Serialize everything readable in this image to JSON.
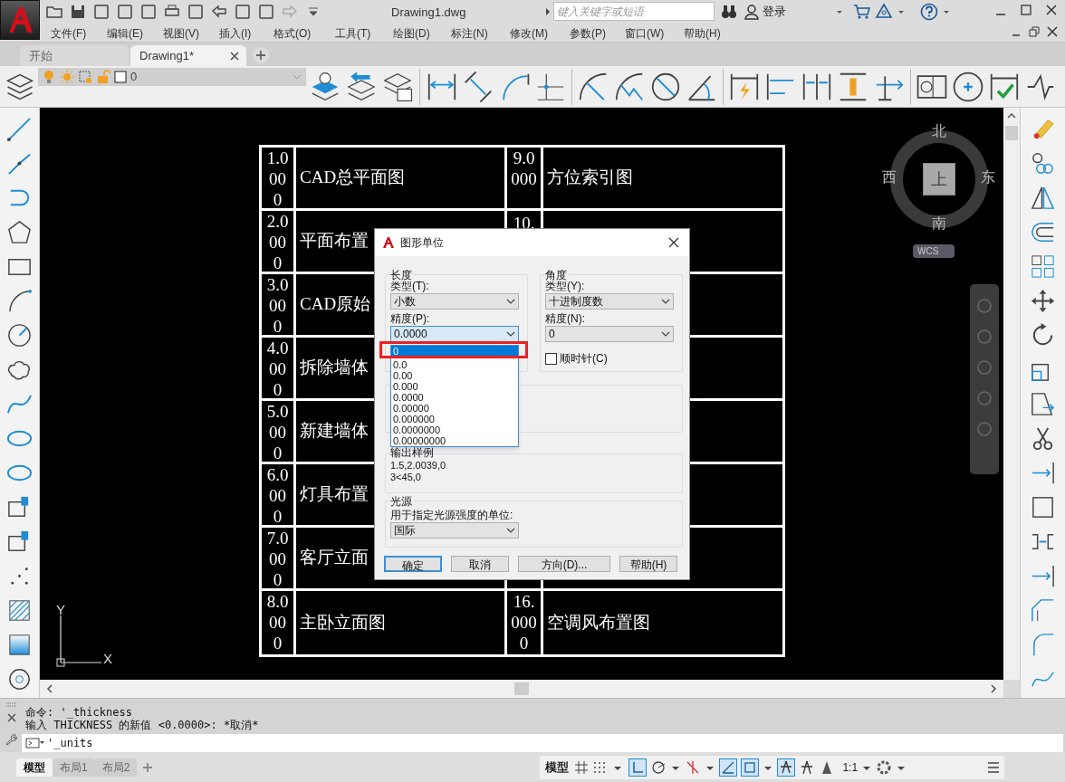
{
  "app": {
    "title": "Drawing1.dwg",
    "search": {
      "placeholder": "键入关键字或短语"
    },
    "login": "登录"
  },
  "menu": [
    "文件(F)",
    "编辑(E)",
    "视图(V)",
    "插入(I)",
    "格式(O)",
    "工具(T)",
    "绘图(D)",
    "标注(N)",
    "修改(M)",
    "参数(P)",
    "窗口(W)",
    "帮助(H)"
  ],
  "doc_tabs": [
    {
      "label": "开始",
      "selected": false
    },
    {
      "label": "Drawing1*",
      "selected": true
    }
  ],
  "layer": {
    "name": "0"
  },
  "drawing_table": {
    "rows": [
      {
        "num": "1.0000",
        "name": "CAD总平面图",
        "num2": "9.0000",
        "name2": "方位索引图"
      },
      {
        "num": "2.0000",
        "name": "平面布置",
        "num2": "10."
      },
      {
        "num": "3.0000",
        "name": "CAD原始"
      },
      {
        "num": "4.0000",
        "name": "拆除墙体"
      },
      {
        "num": "5.0000",
        "name": "新建墙体"
      },
      {
        "num": "6.0000",
        "name": "灯具布置"
      },
      {
        "num": "7.0000",
        "name": "客厅立面"
      },
      {
        "num": "8.0000",
        "name": "主卧立面图",
        "num2": "16.0000",
        "name2": "空调风布置图"
      }
    ]
  },
  "viewcube": {
    "north": "北",
    "south": "南",
    "east": "东",
    "west": "西",
    "top": "上",
    "wcs": "WCS"
  },
  "ucs": {
    "x": "X",
    "y": "Y"
  },
  "dialog": {
    "title": "图形单位",
    "length": {
      "label": "长度",
      "type_label": "类型(T):",
      "type": "小数",
      "precision_label": "精度(P):",
      "precision": "0.0000",
      "options": [
        {
          "label": "0",
          "selected": true
        },
        {
          "label": "0.0",
          "selected": false
        },
        {
          "label": "0.00",
          "selected": false
        },
        {
          "label": "0.000",
          "selected": false
        },
        {
          "label": "0.0000",
          "selected": false
        },
        {
          "label": "0.00000",
          "selected": false
        },
        {
          "label": "0.000000",
          "selected": false
        },
        {
          "label": "0.0000000",
          "selected": false
        },
        {
          "label": "0.00000000",
          "selected": false
        }
      ]
    },
    "angle": {
      "label": "角度",
      "type_label": "类型(Y):",
      "type": "十进制度数",
      "precision_label": "精度(N):",
      "precision": "0",
      "clockwise": {
        "label": "顺时针(C)",
        "checked": false
      }
    },
    "sample": {
      "label": "输出样例",
      "lines": [
        "1.5,2.0039,0",
        "3<45,0"
      ]
    },
    "lighting": {
      "label": "光源",
      "unit_label": "用于指定光源强度的单位:",
      "unit": "国际"
    },
    "buttons": [
      {
        "label": "确定",
        "default": true
      },
      {
        "label": "取消",
        "default": false
      },
      {
        "label": "方向(D)...",
        "default": false
      },
      {
        "label": "帮助(H)",
        "default": false
      }
    ]
  },
  "command": {
    "history": [
      "命令: '_thickness",
      "输入 THICKNESS 的新值 <0.0000>: *取消*"
    ],
    "input": "'_units"
  },
  "layout_tabs": [
    {
      "label": "模型",
      "selected": true
    },
    {
      "label": "布局1",
      "selected": false
    },
    {
      "label": "布局2",
      "selected": false
    }
  ],
  "status_bar": {
    "model": "模型",
    "scale": "1:1"
  }
}
